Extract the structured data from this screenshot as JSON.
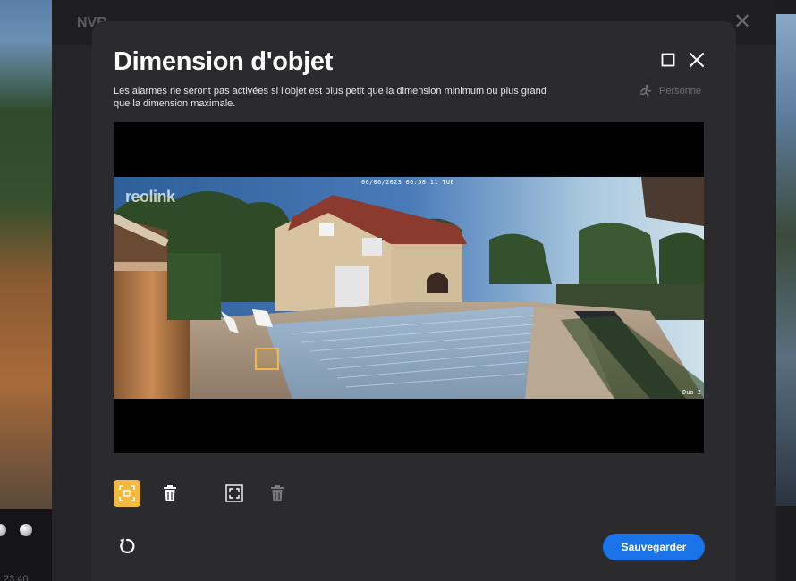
{
  "background": {
    "panel_title": "NVR",
    "time_fragment": "23:40"
  },
  "modal": {
    "title": "Dimension d'objet",
    "description": "Les alarmes ne seront pas activées si l'objet est plus petit que la dimension minimum ou plus grand que la dimension maximale.",
    "object_type_label": "Personne",
    "object_type_icon": "running-person-icon"
  },
  "camera": {
    "timestamp": "06/06/2023 06:58:11 TUE",
    "brand_watermark": "reolink",
    "model_label": "Duo 2"
  },
  "toolbar": {
    "min_size_icon": "min-size-frame-icon",
    "delete_min_icon": "trash-icon",
    "max_size_icon": "max-size-frame-icon",
    "delete_max_icon": "trash-icon-disabled",
    "reset_icon": "reset-icon"
  },
  "actions": {
    "save_label": "Sauvegarder"
  },
  "colors": {
    "accent_selection": "#f6b93f",
    "save_button": "#1a73e8",
    "modal_background": "#2b2b2d"
  }
}
